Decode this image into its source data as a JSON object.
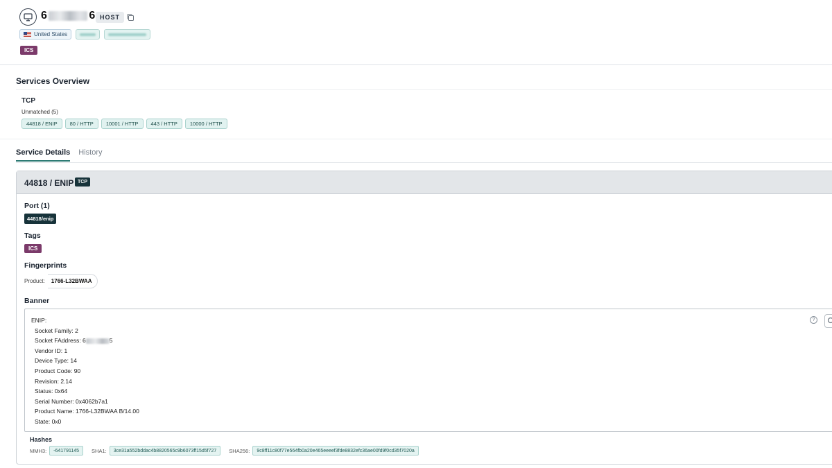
{
  "host": {
    "title_prefix": "6",
    "title_suffix": "6",
    "badge": "HOST",
    "country": "United States",
    "tag": "ICS"
  },
  "services_overview": {
    "title": "Services Overview",
    "protocol": "TCP",
    "group_label": "Unmatched (5)",
    "services": [
      "44818 / ENIP",
      "80 / HTTP",
      "10001 / HTTP",
      "443 / HTTP",
      "10000 / HTTP"
    ]
  },
  "tabs": [
    {
      "label": "Service Details",
      "active": true
    },
    {
      "label": "History",
      "active": false
    }
  ],
  "service": {
    "title": "44818 / ENIP",
    "transport": "TCP",
    "port_title": "Port (1)",
    "port_badge": "44818/enip",
    "tags_title": "Tags",
    "tag": "ICS",
    "fingerprints_title": "Fingerprints",
    "fingerprint_label": "Product:",
    "fingerprint_value": "1766-L32BWAA",
    "banner_title": "Banner",
    "banner": {
      "header": "ENIP:",
      "socket_family": "Socket Family: 2",
      "socket_faddress_prefix": "Socket FAddress: 6",
      "socket_faddress_suffix": "5",
      "vendor_id": "Vendor ID: 1",
      "device_type": "Device Type: 14",
      "product_code": "Product Code: 90",
      "revision": "Revision: 2.14",
      "status": "Status: 0x64",
      "serial_number": "Serial Number: 0x4062b7a1",
      "product_name": "Product Name: 1766-L32BWAA B/14.00",
      "state": "State: 0x0"
    },
    "help_symbol": "?",
    "hashes_title": "Hashes",
    "hashes": [
      {
        "label": "MMH3:",
        "value": "-641791145"
      },
      {
        "label": "SHA1:",
        "value": "3ce31a552bddac4b8820565c9b6073ff15d5f727"
      },
      {
        "label": "SHA256:",
        "value": "9c8ff11c80f77e564fb0a20e465eeeef3fde8832efc36ae00fd9f0cd35f7020a"
      }
    ]
  },
  "icons": [
    "monitor-icon",
    "copy-icon",
    "us-flag-icon",
    "help-icon",
    "search-icon"
  ],
  "colors": {
    "accent_teal": "#2c7a73",
    "chip_teal_bg": "#e1f2f0",
    "ics_purple": "#7b3a6a",
    "dark_badge": "#17333a",
    "card_header_bg": "#e3e6e9"
  }
}
